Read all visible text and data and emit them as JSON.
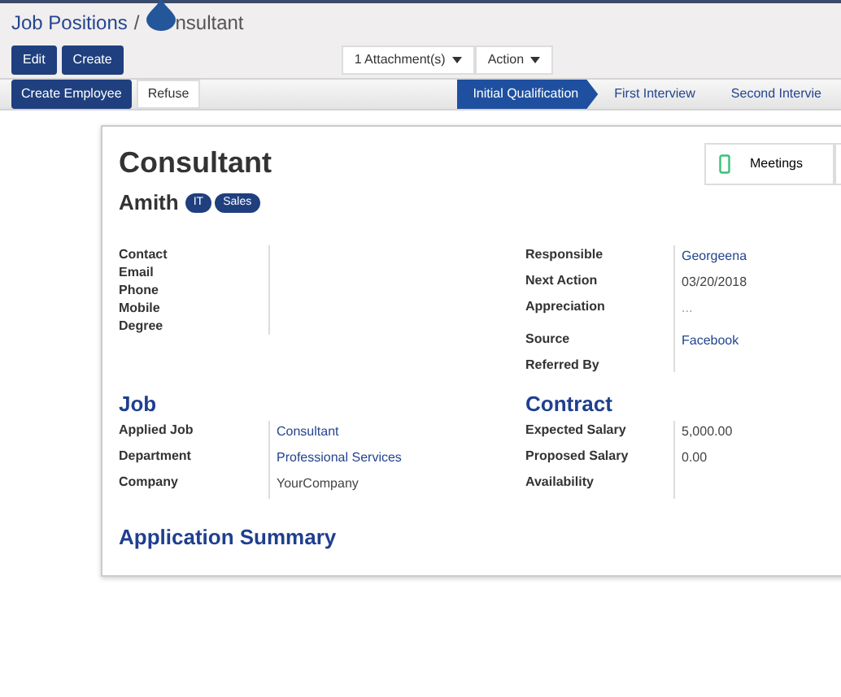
{
  "breadcrumb": {
    "parent": "Job Positions",
    "separator": "/",
    "current_visible": "nsultant"
  },
  "buttons": [
    {
      "label": "Edit",
      "kind": "primary"
    },
    {
      "label": "Create",
      "kind": "primary"
    }
  ],
  "sidebar_buttons": [
    {
      "label": "1 Attachment(s)"
    },
    {
      "label": "Action"
    }
  ],
  "header_buttons": [
    {
      "label": "Create Employee",
      "kind": "primary"
    },
    {
      "label": "Refuse",
      "kind": "default"
    }
  ],
  "stages": [
    {
      "label": "Initial Qualification",
      "selected": true
    },
    {
      "label": "First Interview",
      "selected": false
    },
    {
      "label": "Second Intervie",
      "selected": false
    }
  ],
  "stat_buttons": [
    {
      "label": "Meetings"
    }
  ],
  "title": "Consultant",
  "applicant": {
    "name": "Amith",
    "tags": [
      "IT",
      "Sales"
    ]
  },
  "contact_fields": [
    {
      "label": "Contact"
    },
    {
      "label": "Email"
    },
    {
      "label": "Phone"
    },
    {
      "label": "Mobile"
    },
    {
      "label": "Degree"
    }
  ],
  "right_fields": [
    {
      "label": "Responsible",
      "value": "Georgeena",
      "kind": "link"
    },
    {
      "label": "Next Action",
      "value": "03/20/2018",
      "kind": "text"
    },
    {
      "label": "Appreciation",
      "value": "...",
      "kind": "dots"
    },
    {
      "label": "Source",
      "value": "Facebook",
      "kind": "link"
    },
    {
      "label": "Referred By"
    }
  ],
  "job": {
    "heading": "Job",
    "fields": [
      {
        "label": "Applied Job",
        "value": "Consultant",
        "kind": "link"
      },
      {
        "label": "Department",
        "value": "Professional Services",
        "kind": "link"
      },
      {
        "label": "Company",
        "value": "YourCompany",
        "kind": "text"
      }
    ]
  },
  "contract": {
    "heading": "Contract",
    "fields": [
      {
        "label": "Expected Salary",
        "value": "5,000.00",
        "kind": "text"
      },
      {
        "label": "Proposed Salary",
        "value": "0.00",
        "kind": "text"
      },
      {
        "label": "Availability"
      }
    ]
  },
  "summary_heading": "Application Summary"
}
